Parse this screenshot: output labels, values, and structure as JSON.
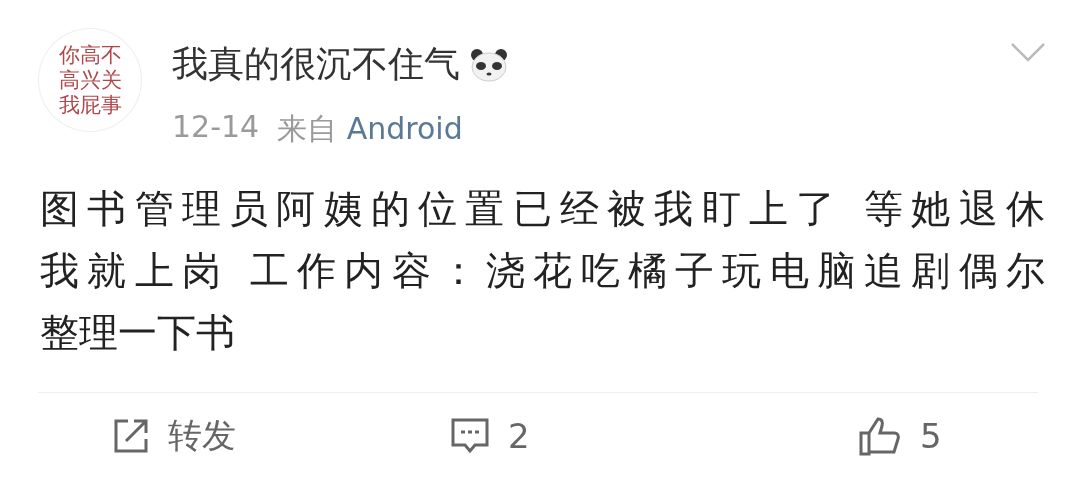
{
  "post": {
    "avatar_lines": [
      "你高不",
      "高兴关",
      "我屁事"
    ],
    "username": "我真的很沉不住气",
    "time": "12-14",
    "source_prefix": "来自",
    "source": "Android",
    "text_lines": [
      "图书管理员阿姨的位置已经被我盯上了 等她退休",
      "我就上岗 工作内容：浇花吃橘子玩电脑追剧偶尔",
      "整理一下书"
    ],
    "actions": [
      {
        "kind": "repost",
        "label": "转发"
      },
      {
        "kind": "comment",
        "label": "2"
      },
      {
        "kind": "like",
        "label": "5"
      }
    ]
  }
}
